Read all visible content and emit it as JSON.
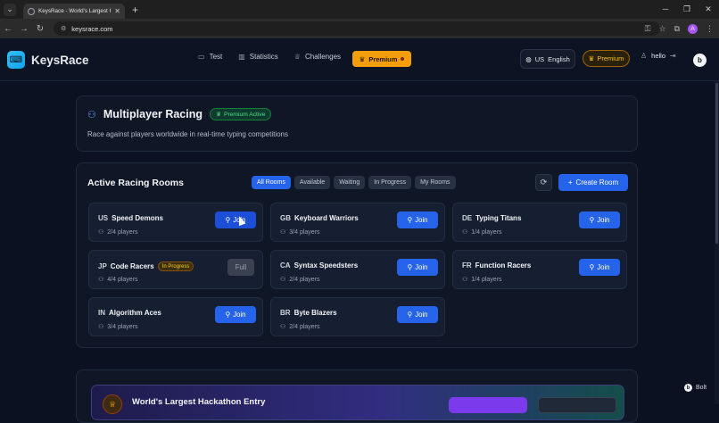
{
  "browser": {
    "tab_title": "KeysRace - World's Largest Hackatho",
    "url": "keysrace.com"
  },
  "header": {
    "app_name": "KeysRace",
    "nav": [
      {
        "label": "Test",
        "icon": "keyboard-icon"
      },
      {
        "label": "Statistics",
        "icon": "bar-chart-icon"
      },
      {
        "label": "Challenges",
        "icon": "trophy-icon"
      }
    ],
    "premium_button": "Premium",
    "language": {
      "code": "US",
      "label": "English"
    },
    "premium_badge": "Premium",
    "username": "hello"
  },
  "intro": {
    "title": "Multiplayer Racing",
    "badge": "Premium Active",
    "subtitle": "Race against players worldwide in real-time typing competitions"
  },
  "rooms": {
    "title": "Active Racing Rooms",
    "filters": [
      "All Rooms",
      "Available",
      "Waiting",
      "In Progress",
      "My Rooms"
    ],
    "active_filter": "All Rooms",
    "create_label": "Create Room",
    "join_label": "Join",
    "full_label": "Full",
    "items": [
      {
        "cc": "US",
        "name": "Speed Demons",
        "players": "2/4 players",
        "status": "join"
      },
      {
        "cc": "GB",
        "name": "Keyboard Warriors",
        "players": "3/4 players",
        "status": "join"
      },
      {
        "cc": "DE",
        "name": "Typing Titans",
        "players": "1/4 players",
        "status": "join"
      },
      {
        "cc": "JP",
        "name": "Code Racers",
        "players": "4/4 players",
        "status": "full",
        "badge": "In Progress"
      },
      {
        "cc": "CA",
        "name": "Syntax Speedsters",
        "players": "2/4 players",
        "status": "join"
      },
      {
        "cc": "FR",
        "name": "Function Racers",
        "players": "1/4 players",
        "status": "join"
      },
      {
        "cc": "IN",
        "name": "Algorithm Aces",
        "players": "3/4 players",
        "status": "join"
      },
      {
        "cc": "BR",
        "name": "Byte Blazers",
        "players": "2/4 players",
        "status": "join"
      }
    ]
  },
  "hackathon": {
    "title": "World's Largest Hackathon Entry"
  },
  "footer": {
    "bolt_label": "Bolt"
  },
  "colors": {
    "accent": "#2563eb",
    "premium": "#f59e0b",
    "success": "#4ade80",
    "background": "#0b1120"
  }
}
